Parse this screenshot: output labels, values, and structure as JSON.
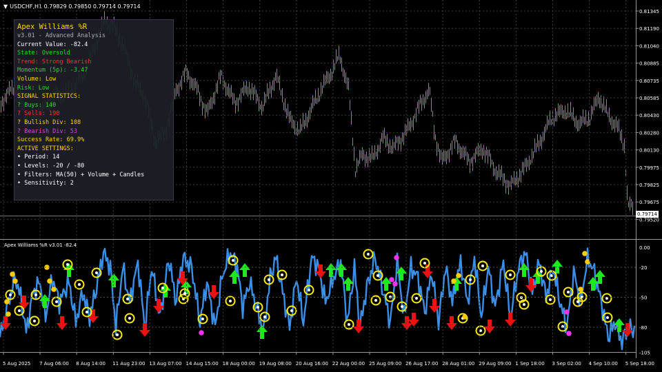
{
  "window_title": "USDCHF,H1  0.79829 0.79850 0.79714 0.79714",
  "current_price": "0.79714",
  "price_axis": [
    "0.81345",
    "0.81190",
    "0.81040",
    "0.80885",
    "0.80735",
    "0.80585",
    "0.80430",
    "0.80280",
    "0.80130",
    "0.79975",
    "0.79825",
    "0.79675",
    "0.79520"
  ],
  "indicator": {
    "title": "Apex Williams %R v3.01 -82.4",
    "levels": [
      "0.00",
      "-20",
      "-50",
      "-80",
      "-105"
    ],
    "level_values": [
      0,
      -20,
      -50,
      -80,
      -105
    ]
  },
  "time_axis": [
    "5 Aug 2025",
    "7 Aug 06:00",
    "8 Aug 14:00",
    "11 Aug 23:00",
    "13 Aug 07:00",
    "14 Aug 15:00",
    "18 Aug 00:00",
    "19 Aug 08:00",
    "20 Aug 16:00",
    "22 Aug 00:00",
    "25 Aug 09:00",
    "26 Aug 17:00",
    "28 Aug 01:00",
    "29 Aug 09:00",
    "1 Sep 18:00",
    "3 Sep 02:00",
    "4 Sep 10:00",
    "5 Sep 18:00"
  ],
  "panel": {
    "title": "Apex Williams %R",
    "subtitle": "v3.01 - Advanced Analysis",
    "lines": [
      {
        "text": "Current Value: -82.4",
        "color": "#ffffff"
      },
      {
        "text": "State: Oversold",
        "color": "#22dd22"
      },
      {
        "text": "Trend: Strong Bearish",
        "color": "#ff3030"
      },
      {
        "text": "Momentum (5p): -3.47",
        "color": "#22dd22"
      },
      {
        "text": "Volume: Low",
        "color": "#ffd700"
      },
      {
        "text": "Risk: Low",
        "color": "#22dd22"
      },
      {
        "text": "SIGNAL STATISTICS:",
        "color": "#ffd700"
      },
      {
        "text": "? Buys: 140",
        "color": "#22dd22"
      },
      {
        "text": "? Sells: 190",
        "color": "#ff3030"
      },
      {
        "text": "? Bullish Div: 108",
        "color": "#ffd700"
      },
      {
        "text": "? Bearish Div: 53",
        "color": "#dd44dd"
      },
      {
        "text": "Success Rate: 69.9%",
        "color": "#ffd700"
      },
      {
        "text": "ACTIVE SETTINGS:",
        "color": "#ffd700"
      },
      {
        "text": "• Period: 14",
        "color": "#ffffff"
      },
      {
        "text": "• Levels: -20 / -80",
        "color": "#ffffff"
      },
      {
        "text": "• Filters: MA(50) + Volume + Candles",
        "color": "#ffffff"
      },
      {
        "text": "• Sensitivity: 2",
        "color": "#ffffff"
      }
    ]
  },
  "colors": {
    "candle": "#1fd11f",
    "wpr_line": "#3a8fe8",
    "buy_arrow": "#1ee81e",
    "sell_arrow": "#ee1111",
    "div_circle": "#ffee00",
    "bear_div": "#ee33ee",
    "grid": "#3c3c3c"
  }
}
